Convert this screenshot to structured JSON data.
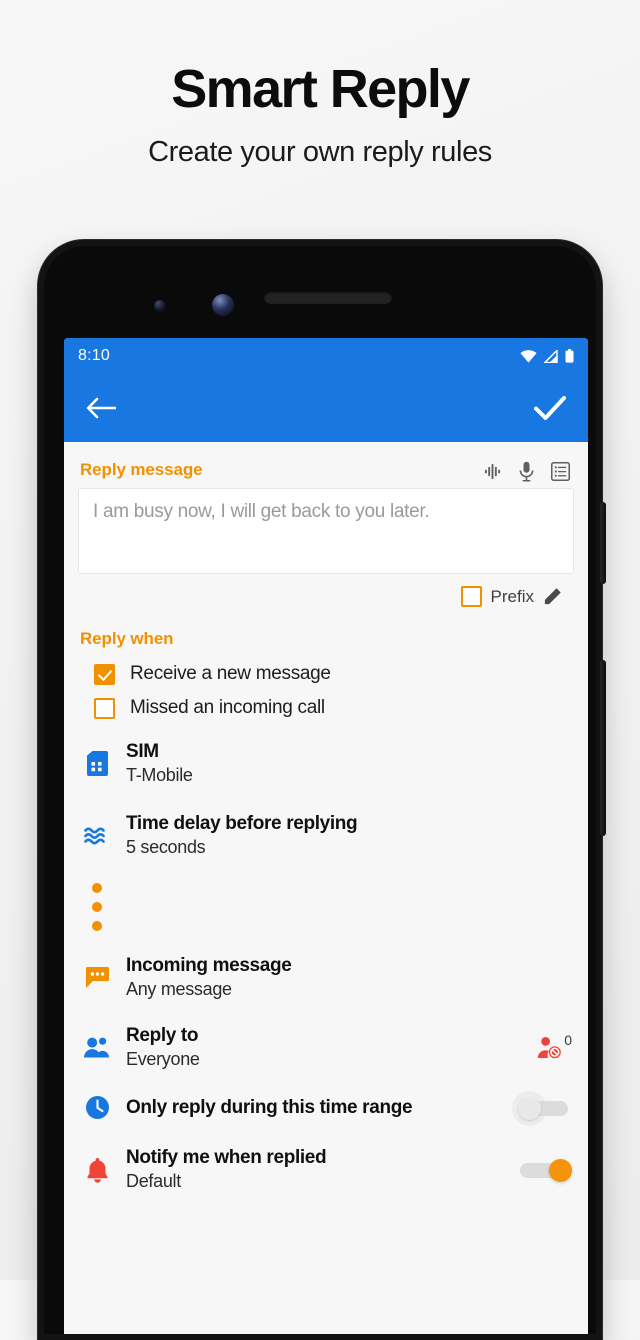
{
  "promo": {
    "title": "Smart Reply",
    "subtitle": "Create your own reply rules"
  },
  "statusbar": {
    "time": "8:10",
    "icons": [
      "wifi-icon",
      "signal-icon",
      "battery-icon"
    ]
  },
  "appbar": {
    "back_icon": "back-arrow-icon",
    "confirm_icon": "checkmark-icon",
    "color": "#1877E0"
  },
  "reply_message": {
    "label": "Reply message",
    "placeholder": "I am busy now, I will get back to you later.",
    "value": "",
    "actions": [
      "assistant-dots-icon",
      "microphone-icon",
      "templates-list-icon"
    ],
    "prefix": {
      "label": "Prefix",
      "checked": false,
      "edit_icon": "pencil-icon"
    }
  },
  "reply_when": {
    "label": "Reply when",
    "options": [
      {
        "label": "Receive a new message",
        "checked": true
      },
      {
        "label": "Missed an incoming call",
        "checked": false
      }
    ]
  },
  "settings_rows": [
    {
      "icon": "sim-card-icon",
      "title": "SIM",
      "subtitle": "T-Mobile"
    },
    {
      "icon": "wave-delay-icon",
      "title": "Time delay before replying",
      "subtitle": "5 seconds"
    }
  ],
  "separator": {
    "icon": "three-dots-vertical",
    "dots": 3
  },
  "condition_rows": [
    {
      "icon": "chat-bubble-icon",
      "title": "Incoming message",
      "subtitle": "Any message"
    },
    {
      "icon": "people-icon",
      "title": "Reply to",
      "subtitle": "Everyone",
      "badge": {
        "icon": "blocked-user-icon",
        "count": "0"
      }
    },
    {
      "icon": "clock-icon",
      "title": "Only reply during this time range",
      "subtitle": "",
      "toggle": "off"
    },
    {
      "icon": "bell-icon",
      "title": "Notify me when replied",
      "subtitle": "Default",
      "toggle": "on"
    }
  ],
  "colors": {
    "accent_orange": "#F29100",
    "accent_blue": "#1877E0",
    "accent_red": "#F04438",
    "screen_bg": "#F7F7F7"
  }
}
